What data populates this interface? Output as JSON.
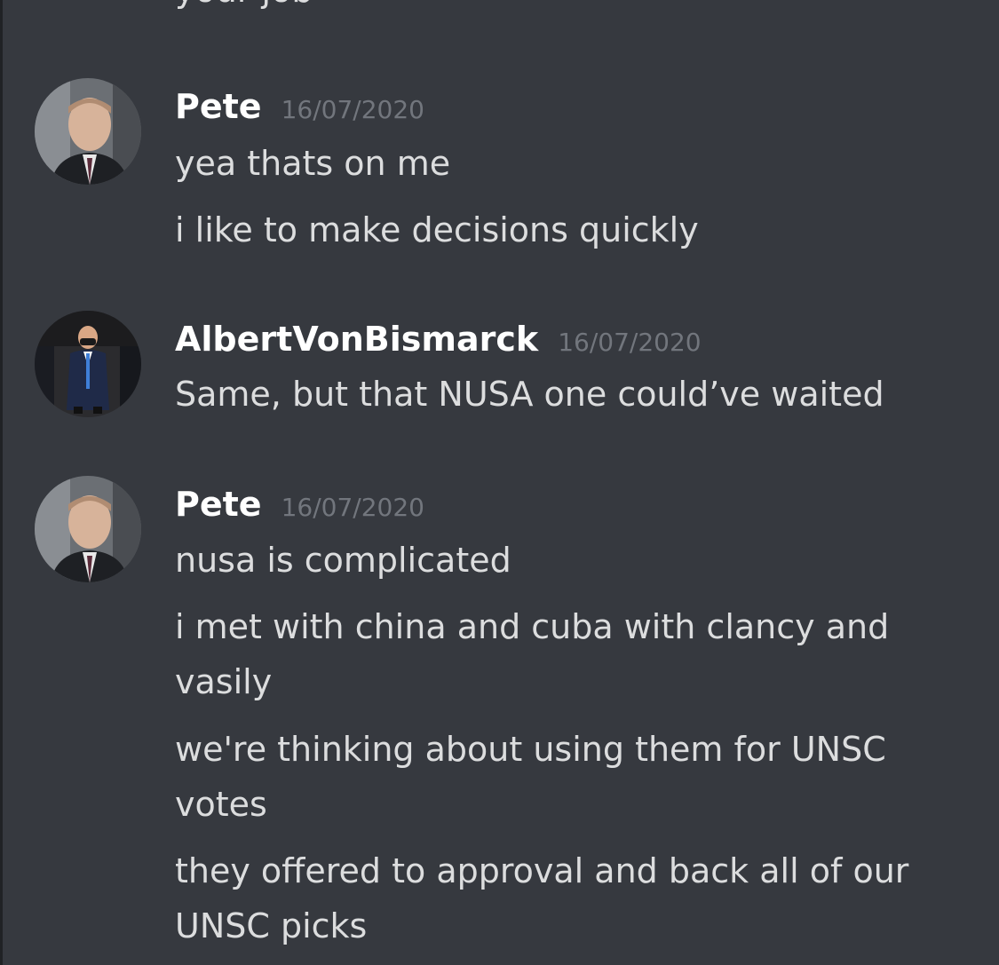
{
  "cutoff_text": "your job",
  "messages": [
    {
      "username": "Pete",
      "timestamp": "16/07/2020",
      "lines": [
        "yea thats on me",
        "i like to make decisions quickly"
      ]
    },
    {
      "username": "AlbertVonBismarck",
      "timestamp": "16/07/2020",
      "lines": [
        "Same, but that NUSA one could’ve waited"
      ]
    },
    {
      "username": "Pete",
      "timestamp": "16/07/2020",
      "lines": [
        "nusa is complicated",
        "i met with china and cuba with clancy and",
        "vasily",
        "we're thinking about using them for UNSC",
        "votes",
        "they offered to approval and back all of our",
        "UNSC picks"
      ]
    }
  ],
  "colors": {
    "background": "#36393f",
    "username": "#ffffff",
    "timestamp": "#72767d",
    "text": "#dcddde"
  }
}
